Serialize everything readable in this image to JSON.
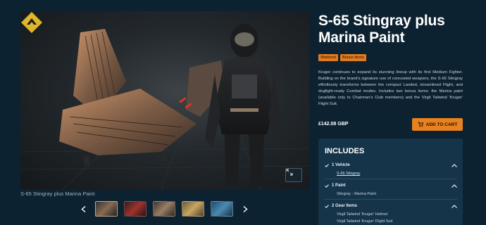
{
  "product": {
    "title": "S-65 Stingray plus Marina Paint",
    "tags": [
      "Warbond",
      "Bonus Items"
    ],
    "description": "Kruger continues to expand its stunning lineup with its first Medium Fighter. Building on the brand's signature use of concealed weapons, the S-65 Stingray effortlessly transforms between the compact Landed, streamlined Flight, and dogfight-ready Combat modes. Includes two bonus items: the Marina paint (available only to Chairman's Club members) and the Virgil Tailwind 'Kruger' Flight Suit.",
    "price": "£142.08 GBP",
    "add_to_cart": "ADD TO CART"
  },
  "gallery": {
    "caption": "S-65 Stingray plus Marina Paint",
    "thumbnails": [
      "thumb-1",
      "thumb-2",
      "thumb-3",
      "thumb-4",
      "thumb-5"
    ],
    "active_index": 0
  },
  "includes": {
    "heading": "INCLUDES",
    "groups": [
      {
        "label": "1 Vehicle",
        "items": [
          "S-65 Stingray"
        ]
      },
      {
        "label": "1 Paint",
        "items": [
          "Stingray - Marina Paint"
        ]
      },
      {
        "label": "2 Gear Items",
        "items": [
          "Virgil Tailwind 'Kruger' Helmet",
          "Virgil Tailwind 'Kruger' Flight Suit"
        ]
      }
    ]
  },
  "colors": {
    "background": "#0d2230",
    "accent": "#e8821f",
    "panel": "#163449"
  },
  "icons": {
    "brand": "kruger-logo-icon",
    "expand": "expand-icon",
    "cart": "cart-icon",
    "check": "check-icon",
    "chevron": "chevron-up-icon",
    "prev": "chevron-left-icon",
    "next": "chevron-right-icon"
  }
}
